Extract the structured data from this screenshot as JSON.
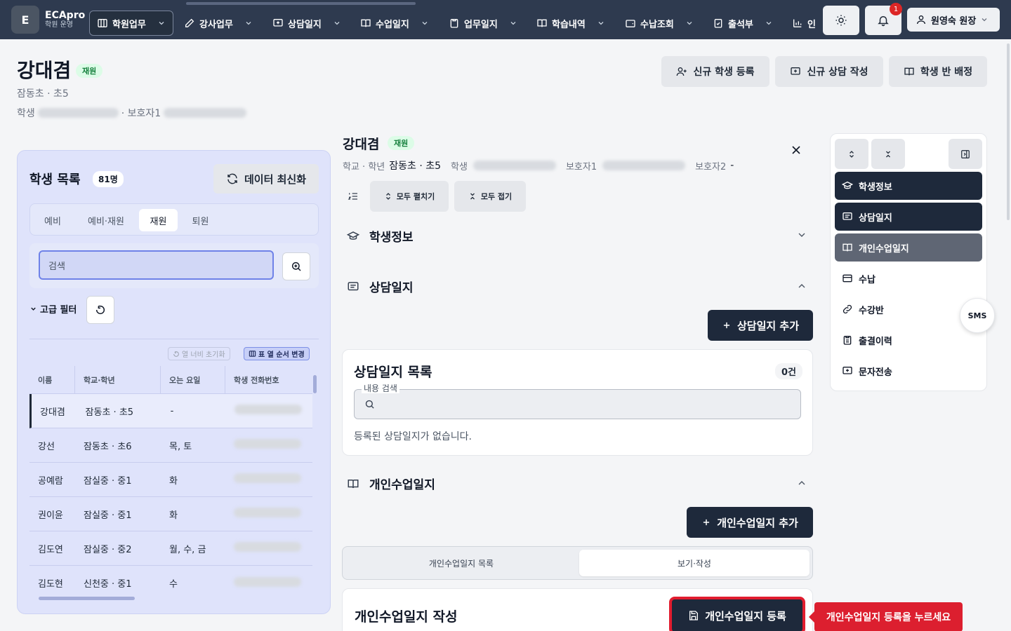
{
  "brand": {
    "logo": "E",
    "name": "ECApro",
    "sub": "학원 운영"
  },
  "nav": {
    "items": [
      {
        "label": "학원업무",
        "icon": "building-icon"
      },
      {
        "label": "강사업무",
        "icon": "edit-icon"
      },
      {
        "label": "상담일지",
        "icon": "message-plus-icon"
      },
      {
        "label": "수업일지",
        "icon": "book-icon"
      },
      {
        "label": "업무일지",
        "icon": "clipboard-icon"
      },
      {
        "label": "학습내역",
        "icon": "book-open-icon"
      },
      {
        "label": "수납조회",
        "icon": "wallet-icon"
      },
      {
        "label": "출석부",
        "icon": "clipboard-check-icon"
      },
      {
        "label": "인",
        "icon": "chart-icon"
      }
    ],
    "notification_count": "1",
    "user": "원영숙 원장"
  },
  "header": {
    "name": "강대겸",
    "status": "재원",
    "school": "잠동초 · 초5",
    "phone_label": "학생",
    "guardian_label": "· 보호자1",
    "buttons": {
      "new_student": "신규 학생 등록",
      "new_consult": "신규 상담 작성",
      "assign_class": "학생 반 배정"
    }
  },
  "student_list": {
    "title": "학생 목록",
    "count": "81명",
    "refresh": "데이터 최신화",
    "tabs": [
      "예비",
      "예비·재원",
      "재원",
      "퇴원"
    ],
    "active_tab": "재원",
    "search_placeholder": "검색",
    "advanced_filter": "고급 필터",
    "reset_width": "열 너비 초기화",
    "change_order": "표 열 순서 변경",
    "columns": [
      "이름",
      "학교·학년",
      "오는 요일",
      "학생 전화번호"
    ],
    "rows": [
      {
        "name": "강대겸",
        "school": "잠동초 · 초5",
        "days": "-"
      },
      {
        "name": "강선",
        "school": "잠동초 · 초6",
        "days": "목, 토"
      },
      {
        "name": "공예람",
        "school": "잠실중 · 중1",
        "days": "화"
      },
      {
        "name": "권이윤",
        "school": "잠실중 · 중1",
        "days": "화"
      },
      {
        "name": "김도연",
        "school": "잠실중 · 중2",
        "days": "월, 수, 금"
      },
      {
        "name": "김도현",
        "school": "신천중 · 중1",
        "days": "수"
      }
    ]
  },
  "detail": {
    "name": "강대겸",
    "status": "재원",
    "school_label": "학교 · 학년",
    "school_value": "잠동초 · 초5",
    "phone_label": "학생",
    "guardian1_label": "보호자1",
    "guardian2_label": "보호자2",
    "guardian2_value": "-",
    "expand_all": "모두 펼치기",
    "collapse_all": "모두 접기",
    "sections": {
      "student_info": "학생정보",
      "consult_log": "상담일지",
      "personal_log": "개인수업일지"
    },
    "add_consult": "상담일지 추가",
    "consult_list_title": "상담일지 목록",
    "consult_count": "0건",
    "content_search_label": "내용 검색",
    "empty_message": "등록된 상담일지가 없습니다.",
    "add_personal": "개인수업일지 추가",
    "personal_tabs": [
      "개인수업일지 목록",
      "보기·작성"
    ],
    "write_title": "개인수업일지 작성",
    "register_button": "개인수업일지 등록",
    "tooltip": "개인수업일지 등록을 누르세요"
  },
  "side_nav": {
    "items": [
      "학생정보",
      "상담일지",
      "개인수업일지",
      "수납",
      "수강반",
      "출결이력",
      "문자전송"
    ],
    "sms": "SMS"
  }
}
